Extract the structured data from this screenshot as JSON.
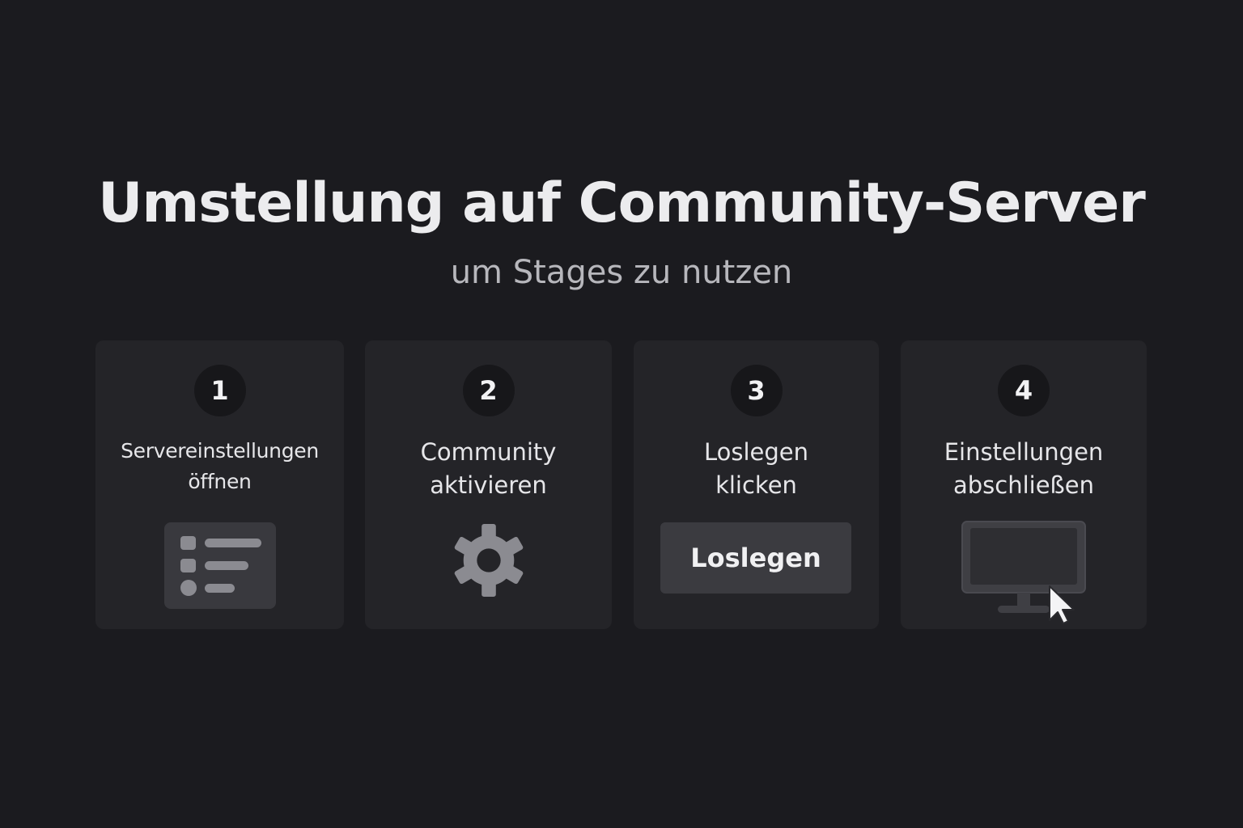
{
  "header": {
    "title": "Umstellung auf Community-Server",
    "subtitle": "um Stages zu nutzen"
  },
  "steps": [
    {
      "number": "1",
      "label_lines": [
        "Servereinstellungen",
        "öffnen"
      ],
      "icon": "list-icon"
    },
    {
      "number": "2",
      "label_lines": [
        "Community",
        "aktivieren"
      ],
      "icon": "gear-icon"
    },
    {
      "number": "3",
      "label_lines": [
        "Loslegen",
        "klicken"
      ],
      "button_label": "Loslegen"
    },
    {
      "number": "4",
      "label_lines": [
        "Einstellungen",
        "abschließen"
      ],
      "icon": "monitor-cursor-icon"
    }
  ],
  "colors": {
    "background": "#1b1b1f",
    "card": "#242428",
    "badge": "#17171a",
    "icon_gray": "#8b8b91",
    "button": "#3b3b40"
  }
}
